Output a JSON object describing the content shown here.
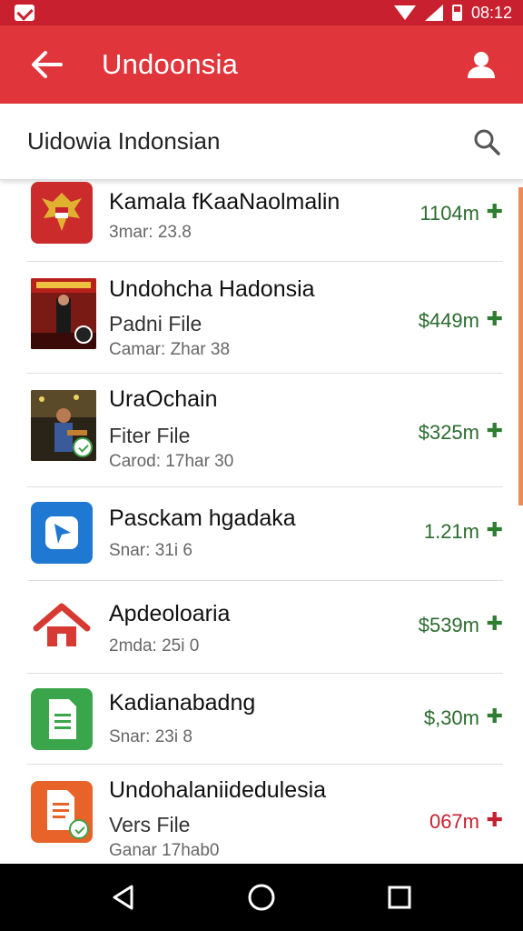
{
  "status_bar": {
    "time": "08:12"
  },
  "app_bar": {
    "title": "Undoonsia"
  },
  "search": {
    "value": "Uidowia Indonsian"
  },
  "items": [
    {
      "title": "Kamala fKaaNaolmalin",
      "subtitle": "",
      "meta": "3mar: 23.8",
      "price": "1104m",
      "icon": "garuda-emblem-icon",
      "price_color": "green"
    },
    {
      "title": "Undohcha Hadonsia",
      "subtitle": "Padni File",
      "meta": "Camar: Zhar 38",
      "price": "$449m",
      "icon": "movie-poster-thumbnail",
      "price_color": "green"
    },
    {
      "title": "UraOchain",
      "subtitle": "Fiter File",
      "meta": "Carod: 17har 30",
      "price": "$325m",
      "icon": "performer-photo-thumbnail",
      "price_color": "green"
    },
    {
      "title": "Pasckam hgadaka",
      "subtitle": "",
      "meta": "Snar: 31i 6",
      "price": "1.21m",
      "icon": "blue-arrow-app-icon",
      "price_color": "green"
    },
    {
      "title": "Apdeoloaria",
      "subtitle": "",
      "meta": "2mda: 25i 0",
      "price": "$539m",
      "icon": "home-icon",
      "price_color": "green"
    },
    {
      "title": "Kadianabadng",
      "subtitle": "",
      "meta": "Snar: 23i 8",
      "price": "$,30m",
      "icon": "document-green-icon",
      "price_color": "green"
    },
    {
      "title": "Undohalaniidedulesia",
      "subtitle": "Vers File",
      "meta": "Ganar 17hab0",
      "price": "067m",
      "icon": "document-orange-icon",
      "price_color": "red"
    }
  ],
  "nav_bar": {
    "back": "back-nav-icon",
    "home": "home-nav-icon",
    "recents": "recents-nav-icon"
  },
  "colors": {
    "status_bar": "#c8202e",
    "app_bar": "#e0353a",
    "price_green": "#2c6b2f",
    "price_red": "#c62030"
  }
}
